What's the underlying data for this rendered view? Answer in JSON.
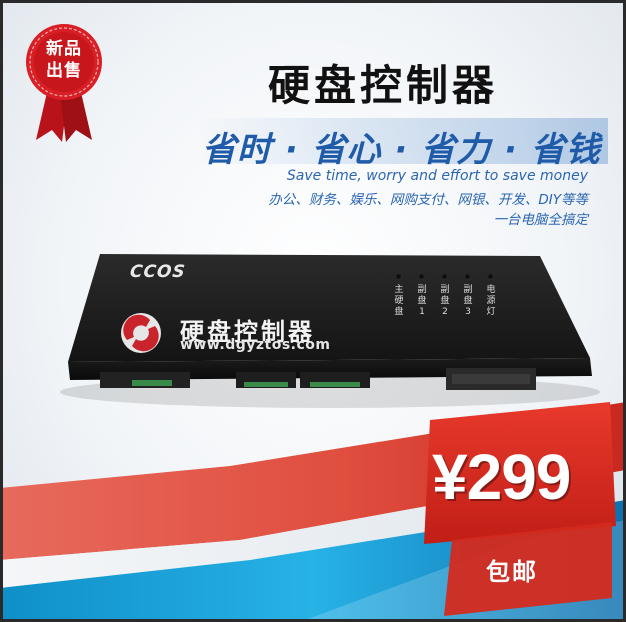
{
  "badge": {
    "line1": "新品",
    "line2": "出售",
    "color": "#c8161d"
  },
  "header": {
    "title": "硬盘控制器",
    "slogan": "省时 · 省心 · 省力 · 省钱",
    "tagline_en": "Save time, worry and effort to save money",
    "uses": "办公、财务、娱乐、网购支付、网银、开发、DIY等等",
    "summary": "一台电脑全搞定"
  },
  "device": {
    "brand": "CCOS",
    "name": "硬盘控制器",
    "url": "www.dgyztos.com",
    "indicators": [
      {
        "label": "主硬盘"
      },
      {
        "label": "副盘1"
      },
      {
        "label": "副盘2"
      },
      {
        "label": "副盘3"
      },
      {
        "label": "电源灯"
      }
    ]
  },
  "pricing": {
    "price": "¥299",
    "shipping": "包邮",
    "accent_color": "#d42a1e",
    "band_color": "#1da1d8"
  }
}
